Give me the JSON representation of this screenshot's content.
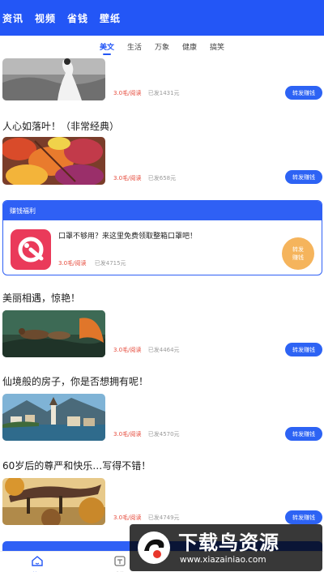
{
  "top_tabs": [
    "资讯",
    "视频",
    "省钱",
    "壁纸"
  ],
  "sub_tabs": [
    "美文",
    "生活",
    "万象",
    "健康",
    "搞笑"
  ],
  "articles": [
    {
      "title": "",
      "price": "3.0毛/阅读",
      "forwarded": "已发1431元",
      "share_label": "转发赚钱"
    },
    {
      "title": "人心如落叶！（非常经典）",
      "price": "3.0毛/阅读",
      "forwarded": "已发658元",
      "share_label": "转发赚钱"
    },
    {
      "title": "美丽相遇，惊艳！",
      "price": "3.0毛/阅读",
      "forwarded": "已发4464元",
      "share_label": "转发赚钱"
    },
    {
      "title": "仙境般的房子，你是否想拥有呢！",
      "price": "3.0毛/阅读",
      "forwarded": "已发4570元",
      "share_label": "转发赚钱"
    },
    {
      "title": "60岁后的尊严和快乐…写得不错！",
      "price": "3.0毛/阅读",
      "forwarded": "已发4749元",
      "share_label": "转发赚钱"
    }
  ],
  "promo": {
    "header": "赚钱福利",
    "title": "口罩不够用？来这里免费领取整箱口罩吧！",
    "price": "3.0毛/阅读",
    "forwarded": "已发4715元",
    "button_line1": "转发",
    "button_line2": "赚钱"
  },
  "bottom_nav": [
    "首页",
    "收徒",
    "",
    ""
  ],
  "watermark": {
    "cn": "下载鸟资源",
    "url": "www.xiazainiao.com"
  },
  "colors": {
    "primary": "#2356f6",
    "price": "#e64b3c",
    "promo_button": "#f5b45c"
  }
}
